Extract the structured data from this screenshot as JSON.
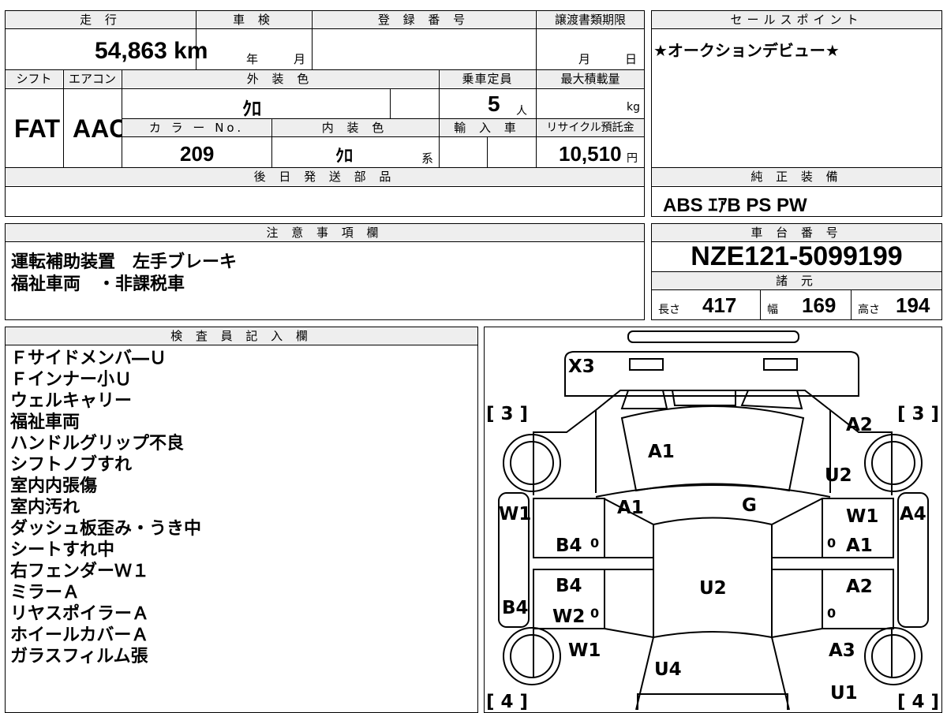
{
  "top": {
    "mileage_label": "走 行",
    "mileage_value": "54,863 km",
    "shaken_label": "車 検",
    "shaken_year": "年",
    "shaken_month": "月",
    "reg_label": "登 録 番 号",
    "transfer_label": "譲渡書類期限",
    "transfer_month": "月",
    "transfer_day": "日",
    "shift_label": "シフト",
    "shift_value": "FAT",
    "ac_label": "エアコン",
    "ac_value": "AAC",
    "ext_color_label": "外 装 色",
    "ext_color_value": "ｸﾛ",
    "capacity_label": "乗車定員",
    "capacity_value": "5",
    "capacity_unit": "人",
    "maxload_label": "最大積載量",
    "maxload_unit": "kg",
    "color_no_label": "カ ラ ー No.",
    "color_no_value": "209",
    "int_color_label": "内 装 色",
    "int_color_value": "ｸﾛ",
    "int_color_suffix": "系",
    "import_label": "輸 入 車",
    "recycle_label": "リサイクル預託金",
    "recycle_value": "10,510",
    "recycle_unit": "円",
    "later_parts_label": "後 日 発 送 部 品"
  },
  "sales": {
    "label": "セールスポイント",
    "text": "★オークションデビュー★"
  },
  "equipment": {
    "label": "純 正 装 備",
    "value": "ABS ｴｱB PS PW"
  },
  "notes": {
    "label": "注 意 事 項 欄",
    "line1": "運転補助装置　左手ブレーキ",
    "line2": "福祉車両　・非課税車"
  },
  "chassis": {
    "label": "車 台 番 号",
    "value": "NZE121-5099199",
    "spec_label": "諸 元",
    "length_label": "長さ",
    "length_value": "417",
    "width_label": "幅",
    "width_value": "169",
    "height_label": "高さ",
    "height_value": "194"
  },
  "inspector": {
    "label": "検 査 員 記 入 欄",
    "lines": [
      "Ｆサイドメンバ―Ｕ",
      "Ｆインナー小Ｕ",
      "ウェルキャリー",
      "福祉車両",
      "ハンドルグリップ不良",
      "シフトノブすれ",
      "室内内張傷",
      "室内汚れ",
      "ダッシュ板歪み・うき中",
      "シートすれ中",
      "右フェンダーＷ１",
      "ミラーＡ",
      "リヤスポイラーＡ",
      "ホイールカバーＡ",
      "ガラスフィルム張"
    ]
  },
  "diagram": {
    "marks": {
      "x3": "X3",
      "tl": "[ 3 ]",
      "tr": "[ 3 ]",
      "bl": "[ 4 ]",
      "br": "[ 4 ]",
      "a2_top": "A2",
      "a1_hood": "A1",
      "u2_right": "U2",
      "a1_center": "A1",
      "g": "G",
      "w1_left": "W1",
      "w1_right": "W1",
      "a4": "A4",
      "b4_left_top": "B4",
      "zero1": "0",
      "zero2": "0",
      "a1_right": "A1",
      "b4_left_mid": "B4",
      "u2_center": "U2",
      "a2_right": "A2",
      "b4_far_left": "B4",
      "w2": "W2",
      "zero3": "0",
      "zero4": "0",
      "w1_lower": "W1",
      "a3": "A3",
      "u4": "U4",
      "u1": "U1"
    }
  }
}
